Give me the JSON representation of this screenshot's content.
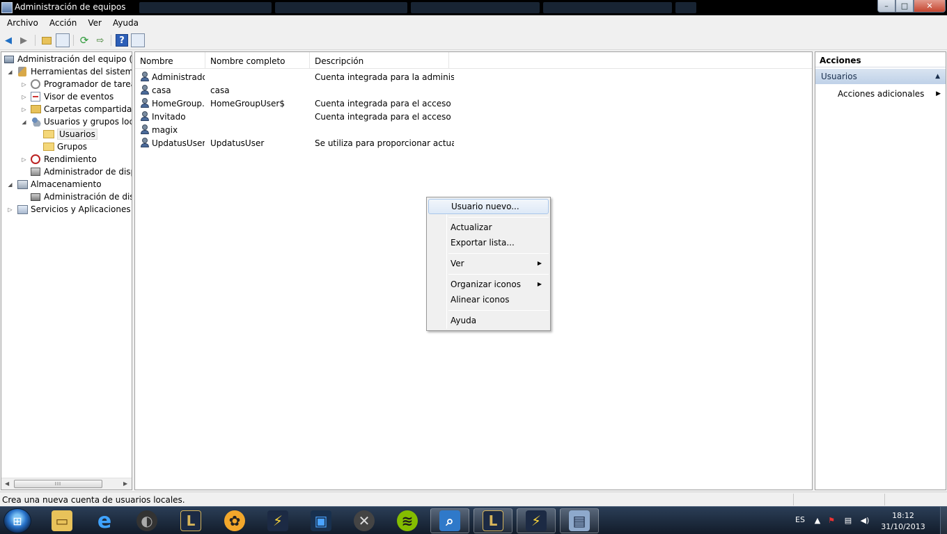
{
  "window": {
    "title": "Administración de equipos",
    "minimize": "–",
    "maximize": "□",
    "close": "✕"
  },
  "menubar": [
    "Archivo",
    "Acción",
    "Ver",
    "Ayuda"
  ],
  "toolbar_icons": [
    "back-arrow-icon",
    "forward-arrow-icon",
    "up-folder-icon",
    "show-hide-tree-icon",
    "refresh-icon",
    "export-list-icon",
    "help-icon",
    "show-action-pane-icon"
  ],
  "tree": {
    "root": "Administración del equipo (local)",
    "system_tools": "Herramientas del sistema",
    "task_scheduler": "Programador de tareas",
    "event_viewer": "Visor de eventos",
    "shared_folders": "Carpetas compartidas",
    "local_users": "Usuarios y grupos locales",
    "users": "Usuarios",
    "groups": "Grupos",
    "performance": "Rendimiento",
    "device_manager": "Administrador de dispositivos",
    "storage": "Almacenamiento",
    "disk_management": "Administración de discos",
    "services": "Servicios y Aplicaciones"
  },
  "list": {
    "columns": [
      "Nombre",
      "Nombre completo",
      "Descripción"
    ],
    "rows": [
      {
        "name": "Administrador",
        "full_name": "",
        "description": "Cuenta integrada para la administ..."
      },
      {
        "name": "casa",
        "full_name": "casa",
        "description": ""
      },
      {
        "name": "HomeGroup...",
        "full_name": "HomeGroupUser$",
        "description": "Cuenta integrada para el acceso d..."
      },
      {
        "name": "Invitado",
        "full_name": "",
        "description": "Cuenta integrada para el acceso c..."
      },
      {
        "name": "magix",
        "full_name": "",
        "description": ""
      },
      {
        "name": "UpdatusUser",
        "full_name": "UpdatusUser",
        "description": "Se utiliza para proporcionar actual..."
      }
    ]
  },
  "context_menu": {
    "new_user": "Usuario nuevo...",
    "refresh": "Actualizar",
    "export": "Exportar lista...",
    "view": "Ver",
    "arrange": "Organizar iconos",
    "align": "Alinear iconos",
    "help": "Ayuda",
    "submenu_arrow": "▶"
  },
  "actions": {
    "title": "Acciones",
    "section": "Usuarios",
    "collapse": "▲",
    "more": "Acciones adicionales",
    "more_arrow": "▶"
  },
  "status": "Crea una nueva cuenta de usuarios locales.",
  "taskbar": {
    "apps": [
      "file-explorer-icon",
      "internet-explorer-icon",
      "media-player-icon",
      "league-of-legends-icon",
      "fl-studio-icon",
      "winamp-icon",
      "network-icon",
      "game-tool-icon",
      "spotify-icon",
      "search-icon",
      "league-of-legends-icon",
      "winamp-icon",
      "computer-management-icon"
    ],
    "lang": "ES",
    "time": "18:12",
    "date": "31/10/2013"
  }
}
